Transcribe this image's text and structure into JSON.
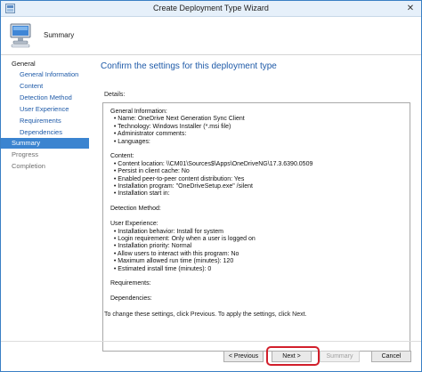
{
  "window": {
    "title": "Create Deployment Type Wizard",
    "close_glyph": "✕"
  },
  "header": {
    "heading": "Summary",
    "icon": "computer-install-icon"
  },
  "nav": {
    "items": [
      {
        "label": "General",
        "state": "normal"
      },
      {
        "label": "General Information",
        "state": "sub"
      },
      {
        "label": "Content",
        "state": "sub"
      },
      {
        "label": "Detection Method",
        "state": "sub"
      },
      {
        "label": "User Experience",
        "state": "sub"
      },
      {
        "label": "Requirements",
        "state": "sub"
      },
      {
        "label": "Dependencies",
        "state": "sub"
      },
      {
        "label": "Summary",
        "state": "active"
      },
      {
        "label": "Progress",
        "state": "disabled"
      },
      {
        "label": "Completion",
        "state": "disabled"
      }
    ]
  },
  "main": {
    "confirm_heading": "Confirm the settings for this deployment type",
    "details_label": "Details:",
    "details_text": "General Information:\n  • Name: OneDrive Next Generation Sync Client\n  • Technology: Windows Installer (*.msi file)\n  • Administrator comments:\n  • Languages:\n\nContent:\n  • Content location: \\\\CM01\\Sources$\\Apps\\OneDriveNG\\17.3.6390.0509\n  • Persist in client cache: No\n  • Enabled peer-to-peer content distribution: Yes\n  • Installation program: \"OneDriveSetup.exe\" /silent\n  • Installation start in:\n\nDetection Method:\n\nUser Experience:\n  • Installation behavior: Install for system\n  • Login requirement: Only when a user is logged on\n  • Installation priority: Normal\n  • Allow users to interact with this program: No\n  • Maximum allowed run time (minutes): 120\n  • Estimated install time (minutes): 0\n\nRequirements:\n\nDependencies:",
    "footnote": "To change these settings, click Previous. To apply the settings, click Next."
  },
  "buttons": {
    "previous": "< Previous",
    "next": "Next >",
    "summary": "Summary",
    "cancel": "Cancel"
  },
  "colors": {
    "accent": "#3b84d0",
    "link": "#1e5aa8",
    "highlight": "#d21f2b"
  }
}
